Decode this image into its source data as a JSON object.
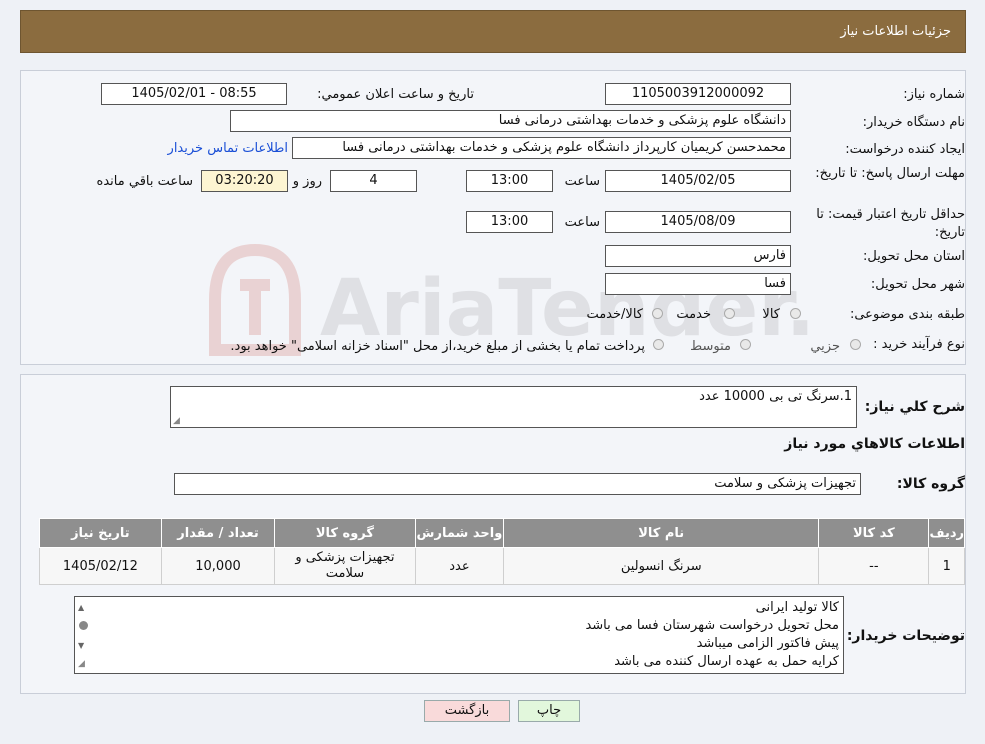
{
  "header": {
    "title": "جزئیات اطلاعات نیاز"
  },
  "form": {
    "need_number_label": "شماره نیاز:",
    "need_number": "1105003912000092",
    "announce_label": "تاريخ و ساعت اعلان عمومي:",
    "announce_value": "1405/02/01 - 08:55",
    "buyer_org_label": "نام دستگاه خريدار:",
    "buyer_org": "دانشگاه علوم پزشکی و خدمات بهداشتی درمانی فسا",
    "requester_label": "ايجاد کننده درخواست:",
    "requester": "محمدحسن کریمیان کارپرداز دانشگاه علوم پزشکی و خدمات بهداشتی درمانی فسا",
    "contact_link": "اطلاعات تماس خريدار",
    "deadline_label": "مهلت ارسال پاسخ: تا تاريخ:",
    "deadline_date": "1405/02/05",
    "time_label": "ساعت",
    "deadline_time": "13:00",
    "days_value": "4",
    "days_label": "روز و",
    "remaining_value": "03:20:20",
    "remaining_label": "ساعت باقي مانده",
    "validity_label": "حداقل تاريخ اعتبار قيمت: تا تاريخ:",
    "validity_date": "1405/08/09",
    "validity_time": "13:00",
    "province_label": "استان محل تحويل:",
    "province": "فارس",
    "city_label": "شهر محل تحويل:",
    "city": "فسا",
    "category_label": "طبقه بندی موضوعی:",
    "category_options": [
      "کالا",
      "خدمت",
      "کالا/خدمت"
    ],
    "process_label": "نوع فرآيند خريد :",
    "process_options": [
      "جزيي",
      "متوسط"
    ],
    "process_note": "پرداخت تمام یا بخشی از مبلغ خرید،از محل \"اسناد خزانه اسلامی\" خواهد بود."
  },
  "details": {
    "summary_label": "شرح کلي نياز:",
    "summary": "1.سرنگ تی بی 10000 عدد",
    "goods_info_title": "اطلاعات کالاهاي مورد نياز",
    "group_label": "گروه کالا:",
    "group_value": "تجهیزات پزشکی و سلامت",
    "table": {
      "headers": [
        "رديف",
        "کد کالا",
        "نام کالا",
        "واحد شمارش",
        "گروه کالا",
        "تعداد / مقدار",
        "تاريخ نياز"
      ],
      "rows": [
        [
          "1",
          "--",
          "سرنگ انسولین",
          "عدد",
          "تجهیزات پزشکی و سلامت",
          "10,000",
          "1405/02/12"
        ]
      ]
    },
    "notes_label": "توضيحات خريدار:",
    "notes": [
      "کالا تولید ایرانی",
      "محل تحویل درخواست شهرستان فسا می باشد",
      "پیش فاکتور الزامی میباشد",
      "کرایه حمل به عهده ارسال کننده می باشد"
    ]
  },
  "buttons": {
    "print": "چاپ",
    "back": "بازگشت"
  },
  "watermark": {
    "text": "AriaTender.neT"
  },
  "colors": {
    "header": "#8b6c3f",
    "remaining_bg": "#fdf5d2",
    "link": "#1a4fd6",
    "back_btn": "#f9dada",
    "print_btn": "#e2f7dc"
  }
}
